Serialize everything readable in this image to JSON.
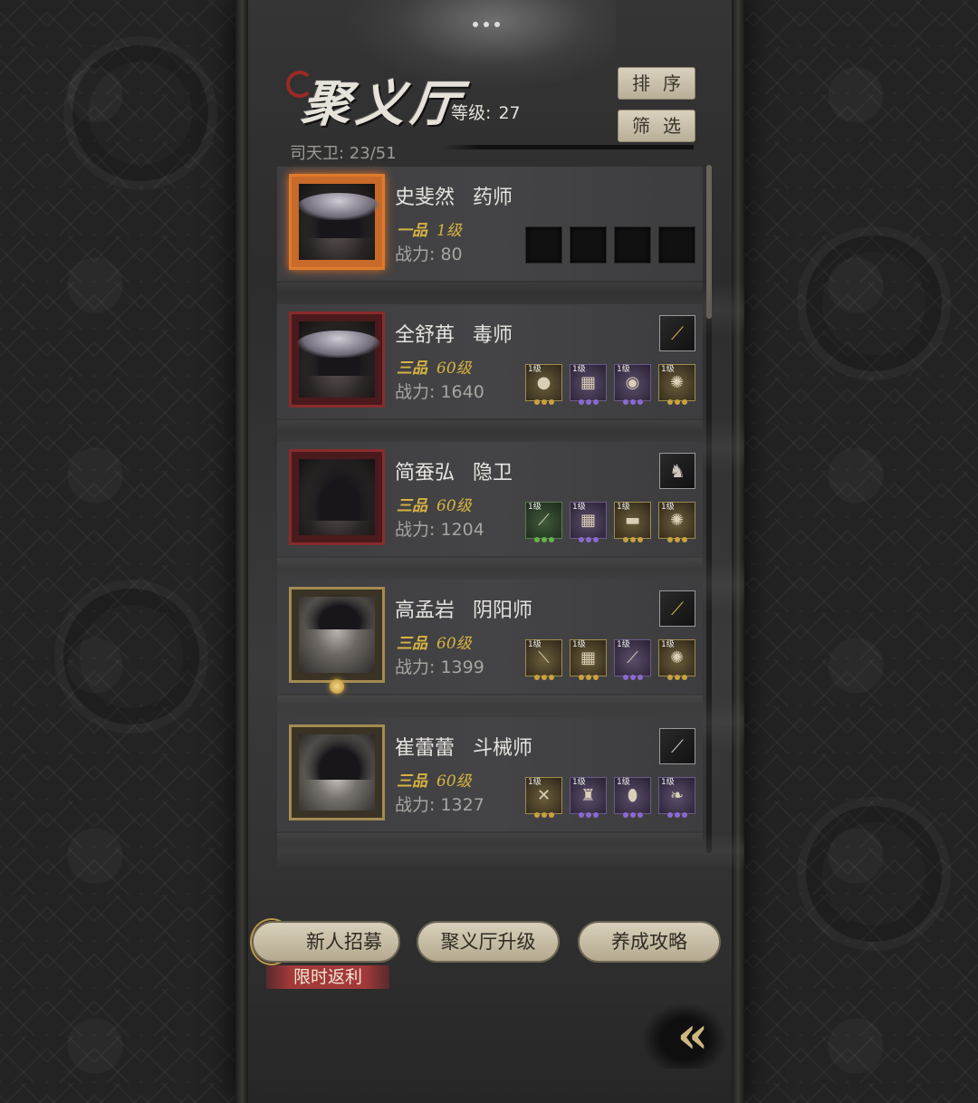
{
  "header": {
    "title": "聚义厅",
    "level_label": "等级:",
    "level_value": "27",
    "sort_label": "排序",
    "filter_label": "筛选",
    "guard_count": "司天卫: 23/51"
  },
  "heroes": [
    {
      "name": "史斐然",
      "role": "药师",
      "rank": "一品",
      "level": "1级",
      "power": "战力: 80",
      "has_weapon": false,
      "equipment": [
        {
          "level": "",
          "icon": "empty-slot"
        },
        {
          "level": "",
          "icon": "empty-slot"
        },
        {
          "level": "",
          "icon": "empty-slot"
        },
        {
          "level": "",
          "icon": "empty-slot"
        }
      ]
    },
    {
      "name": "全舒苒",
      "role": "毒师",
      "rank": "三品",
      "level": "60级",
      "power": "战力: 1640",
      "weapon_icon": "golden-staff-icon",
      "equipment": [
        {
          "level": "1级",
          "icon": "gourd-icon"
        },
        {
          "level": "1级",
          "icon": "armor-icon"
        },
        {
          "level": "1级",
          "icon": "orb-icon"
        },
        {
          "level": "1级",
          "icon": "jade-ornament-icon"
        }
      ]
    },
    {
      "name": "简蚕弘",
      "role": "隐卫",
      "rank": "三品",
      "level": "60级",
      "power": "战力: 1204",
      "weapon_icon": "rabbit-icon",
      "equipment": [
        {
          "level": "1级",
          "icon": "blade-icon"
        },
        {
          "level": "1级",
          "icon": "armor-icon"
        },
        {
          "level": "1级",
          "icon": "scroll-icon"
        },
        {
          "level": "1级",
          "icon": "jade-ornament-icon"
        }
      ]
    },
    {
      "name": "高孟岩",
      "role": "阴阳师",
      "rank": "三品",
      "level": "60级",
      "power": "战力: 1399",
      "weapon_icon": "golden-staff-icon",
      "equipment": [
        {
          "level": "1级",
          "icon": "sword-icon"
        },
        {
          "level": "1级",
          "icon": "armor-icon"
        },
        {
          "level": "1级",
          "icon": "bone-icon"
        },
        {
          "level": "1级",
          "icon": "jade-ornament-icon"
        }
      ]
    },
    {
      "name": "崔蕾蕾",
      "role": "斗械师",
      "rank": "三品",
      "level": "60级",
      "power": "战力: 1327",
      "weapon_icon": "spear-icon",
      "equipment": [
        {
          "level": "1级",
          "icon": "crossbow-icon"
        },
        {
          "level": "1级",
          "icon": "robe-icon"
        },
        {
          "level": "1级",
          "icon": "pot-icon"
        },
        {
          "level": "1级",
          "icon": "feather-icon"
        }
      ]
    }
  ],
  "footer": {
    "recruit_label": "新人招募",
    "recruit_icon_glyph": "傑",
    "limited_tag": "限时返利",
    "upgrade_label": "聚义厅升级",
    "guide_label": "养成攻略",
    "back_glyph": "«"
  },
  "colors": {
    "rank_gold_text": "#d8b343",
    "accent_red": "#a33a3a",
    "button_beige": "#d8d0bb"
  }
}
